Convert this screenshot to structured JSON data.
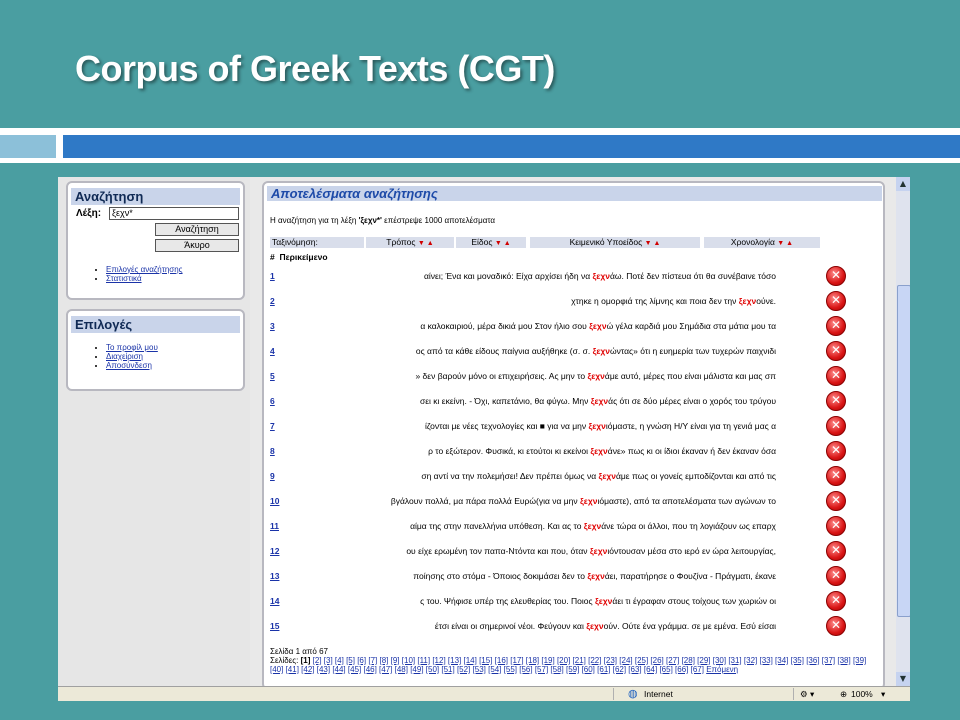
{
  "slide": {
    "title": "Corpus of Greek Texts (CGT)"
  },
  "search_box": {
    "title": "Αναζήτηση",
    "word_label": "Λέξη:",
    "word_value": "ξεχν*",
    "search_button": "Αναζήτηση",
    "cancel_button": "Άκυρο",
    "links": [
      "Επιλογές αναζήτησης",
      "Στατιστικά"
    ]
  },
  "options_box": {
    "title": "Επιλογές",
    "links": [
      "Το προφίλ μου",
      "Διαχείριση",
      "Αποσύνδεση"
    ]
  },
  "results": {
    "title": "Αποτελέσματα αναζήτησης",
    "info_prefix": "Η αναζήτηση για τη λέξη ",
    "info_query": "'ξεχν*'",
    "info_suffix": " επέστρεψε 1000 αποτελέσματα",
    "sort_label": "Ταξινόμηση:",
    "columns": [
      "Τρόπος",
      "Είδος",
      "Κειμενικό Υποείδος",
      "Χρονολογία"
    ],
    "hash_label": "#",
    "text_col": "Περικείμενο",
    "rows": [
      {
        "num": "1",
        "pre": "αίνει; Ένα και μοναδικό: Είχα αρχίσει ήδη να ",
        "kw": "ξεχν",
        "post": "άω. Ποτέ δεν πίστευα ότι θα συνέβαινε τόσο"
      },
      {
        "num": "2",
        "pre": "χτηκε η ομορφιά της λίμνης και ποια δεν την ",
        "kw": "ξεχν",
        "post": "ούνε."
      },
      {
        "num": "3",
        "pre": "α καλοκαιριού, μέρα δικιά μου Στον ήλιο σου ",
        "kw": "ξεχν",
        "post": "ώ γέλα καρδιά μου Σημάδια στα μάτια μου τα"
      },
      {
        "num": "4",
        "pre": "ος από τα κάθε είδους παίγνια αυξήθηκε (σ. σ. ",
        "kw": "ξεχν",
        "post": "ώντας» ότι η ευημερία των τυχερών παιχνιδι"
      },
      {
        "num": "5",
        "pre": "» δεν βαρούν μόνο οι επιχειρήσεις. Ας μην το ",
        "kw": "ξεχν",
        "post": "άμε αυτό, μέρες που είναι μάλιστα και μας σπ"
      },
      {
        "num": "6",
        "pre": "σει κι εκείνη. - Όχι, καπετάνιο, θα φύγω. Μην ",
        "kw": "ξεχν",
        "post": "άς ότι σε δύο μέρες είναι ο χορός του τρύγου"
      },
      {
        "num": "7",
        "pre": "ίζονται με νέες τεχνολογίες και ■ για να μην ",
        "kw": "ξεχν",
        "post": "ιόμαστε, η γνώση Η/Υ είναι για τη γενιά μας α"
      },
      {
        "num": "8",
        "pre": "ρ το εξώτερον. Φυσικά, κι ετούτοι κι εκείνοι ",
        "kw": "ξεχν",
        "post": "άνε» πως κι οι ίδιοι έκαναν ή δεν έκαναν όσα"
      },
      {
        "num": "9",
        "pre": "ση αντί να την πολεμήσει! Δεν πρέπει όμως να ",
        "kw": "ξεχν",
        "post": "άμε πως οι γονείς εμποδίζονται και από τις"
      },
      {
        "num": "10",
        "pre": "βγάλουν πολλά, μα πάρα πολλά Ευρώ(για να μην ",
        "kw": "ξεχν",
        "post": "ιόμαστε), από τα αποτελέσματα των αγώνων το"
      },
      {
        "num": "11",
        "pre": "αίμα της στην πανελλήνια υπόθεση. Και ας το ",
        "kw": "ξεχν",
        "post": "άνε τώρα οι άλλοι, που τη λογιάζουν ως επαρχ"
      },
      {
        "num": "12",
        "pre": "ου είχε ερωμένη τον παπα-Ντόντα και που, όταν ",
        "kw": "ξεχν",
        "post": "ιόντουσαν μέσα στο ιερό εν ώρα λειτουργίας,"
      },
      {
        "num": "13",
        "pre": "ποίησης στο στόμα - Όποιος δοκιμάσει δεν το ",
        "kw": "ξεχν",
        "post": "άει, παρατήρησε ο Φουζίνα - Πράγματι, έκανε"
      },
      {
        "num": "14",
        "pre": "ς του. Ψήφισε υπέρ της ελευθερίας του. Ποιος ",
        "kw": "ξεχν",
        "post": "άει τι έγραφαν στους τοίχους των χωριών οι"
      },
      {
        "num": "15",
        "pre": "έτσι είναι οι σημερινοί νέοι. Φεύγουν και ",
        "kw": "ξεχν",
        "post": "ούν. Ούτε ένα γράμμα. σε με εμένα. Εσύ είσαι"
      }
    ],
    "page_info": "Σελίδα 1 από 67",
    "pages_label": "Σελίδες:",
    "current_page": "[1]",
    "pages": [
      "[2]",
      "[3]",
      "[4]",
      "[5]",
      "[6]",
      "[7]",
      "[8]",
      "[9]",
      "[10]",
      "[11]",
      "[12]",
      "[13]",
      "[14]",
      "[15]",
      "[16]",
      "[17]",
      "[18]",
      "[19]",
      "[20]",
      "[21]",
      "[22]",
      "[23]",
      "[24]",
      "[25]",
      "[26]",
      "[27]",
      "[28]",
      "[29]",
      "[30]",
      "[31]",
      "[32]",
      "[33]",
      "[34]",
      "[35]",
      "[36]",
      "[37]",
      "[38]",
      "[39]",
      "[40]",
      "[41]",
      "[42]",
      "[43]",
      "[44]",
      "[45]",
      "[46]",
      "[47]",
      "[48]",
      "[49]",
      "[50]",
      "[51]",
      "[52]",
      "[53]",
      "[54]",
      "[55]",
      "[56]",
      "[57]",
      "[58]",
      "[59]",
      "[60]",
      "[61]",
      "[62]",
      "[63]",
      "[64]",
      "[65]",
      "[66]",
      "[67]"
    ],
    "next_label": "Επόμενη"
  },
  "statusbar": {
    "zone": "Internet",
    "zoom": "100%"
  }
}
